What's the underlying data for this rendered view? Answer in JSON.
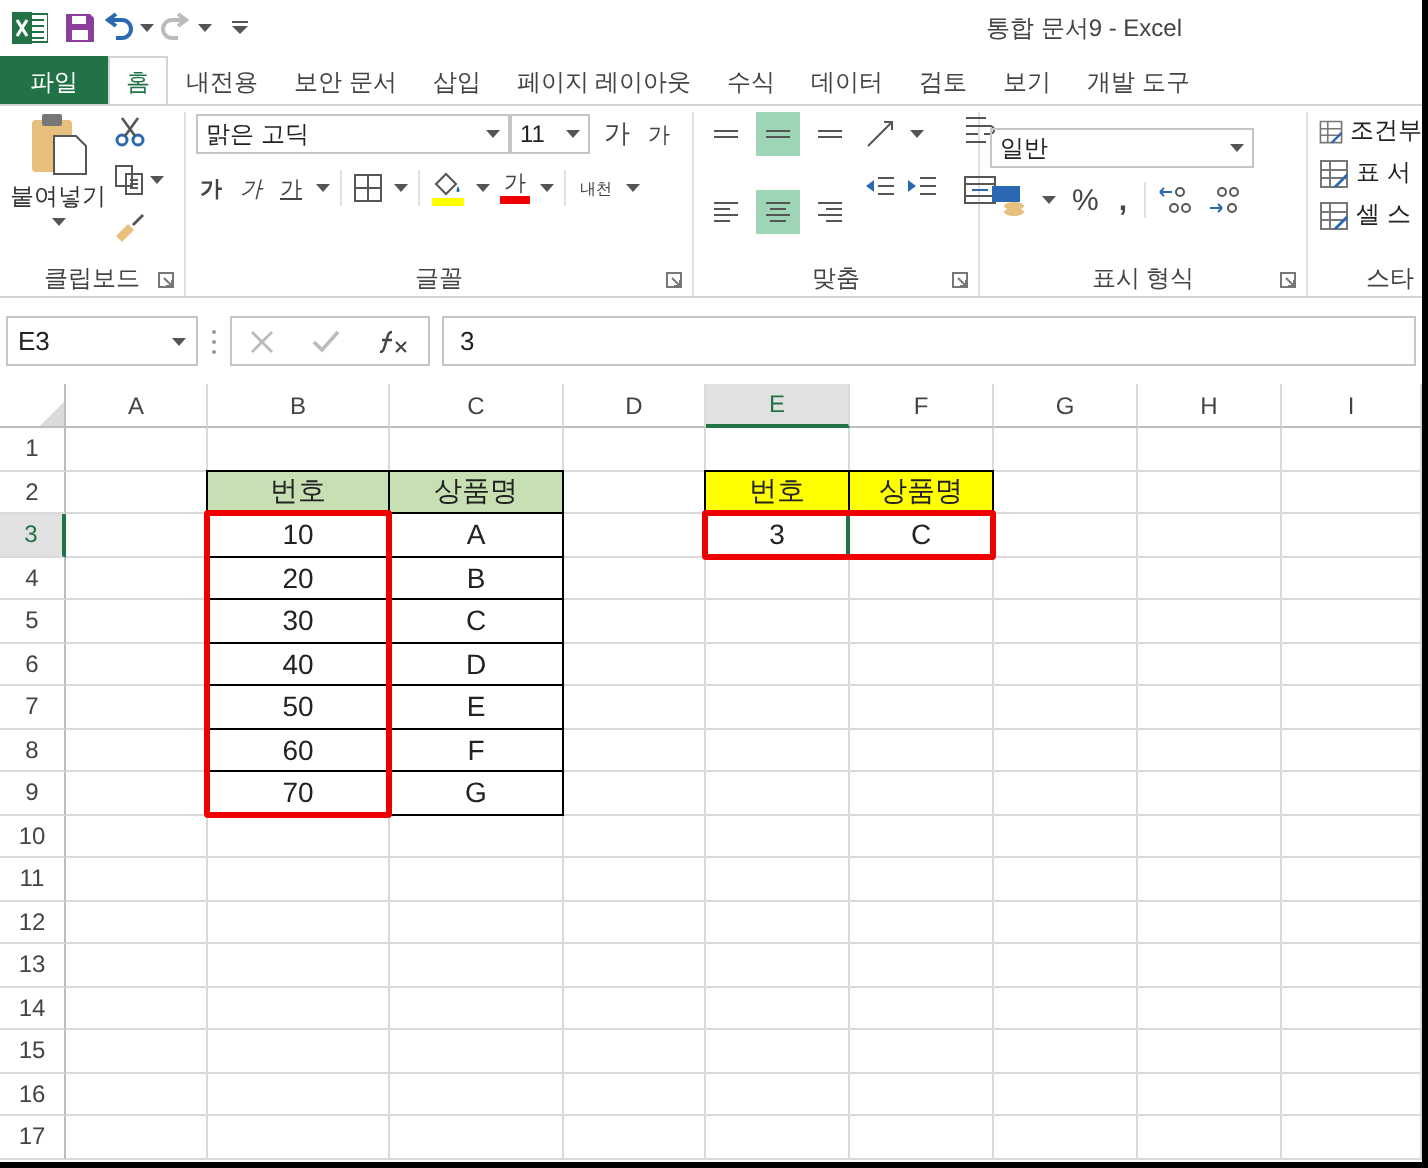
{
  "window": {
    "title": "통합 문서9 - Excel",
    "quick_access": [
      {
        "kind": "save"
      },
      {
        "kind": "undo",
        "disabled": false
      },
      {
        "kind": "redo",
        "disabled": true
      },
      {
        "kind": "customize"
      }
    ]
  },
  "tabs": [
    {
      "label": "파일",
      "kind": "file",
      "selected": false
    },
    {
      "label": "홈",
      "kind": "tab",
      "selected": true
    },
    {
      "label": "내전용",
      "kind": "tab",
      "selected": false
    },
    {
      "label": "보안 문서",
      "kind": "tab",
      "selected": false
    },
    {
      "label": "삽입",
      "kind": "tab",
      "selected": false
    },
    {
      "label": "페이지 레이아웃",
      "kind": "tab",
      "selected": false
    },
    {
      "label": "수식",
      "kind": "tab",
      "selected": false
    },
    {
      "label": "데이터",
      "kind": "tab",
      "selected": false
    },
    {
      "label": "검토",
      "kind": "tab",
      "selected": false
    },
    {
      "label": "보기",
      "kind": "tab",
      "selected": false
    },
    {
      "label": "개발 도구",
      "kind": "tab",
      "selected": false
    }
  ],
  "ribbon": {
    "clipboard": {
      "label": "클립보드",
      "paste": "붙여넣기"
    },
    "font": {
      "label": "글꼴",
      "name": "맑은 고딕",
      "size": "11",
      "grow": "가",
      "shrink": "가",
      "bold": "가",
      "italic": "가",
      "underline": "가",
      "font_color": "가",
      "phonetic": "내천"
    },
    "alignment": {
      "label": "맞춤",
      "buttons": [
        {
          "kind": "top",
          "selected": false
        },
        {
          "kind": "middle",
          "selected": true
        },
        {
          "kind": "bottom",
          "selected": false
        },
        {
          "kind": "left",
          "selected": false
        },
        {
          "kind": "center",
          "selected": true
        },
        {
          "kind": "right",
          "selected": false
        }
      ]
    },
    "number": {
      "label": "표시 형식",
      "format": "일반",
      "percent": "%",
      "comma": ","
    },
    "styles": {
      "label": "스타",
      "items": [
        "조건부",
        "표 서",
        "셀 스"
      ]
    }
  },
  "formula_bar": {
    "name_box": "E3",
    "value": "3"
  },
  "sheet": {
    "columns": [
      {
        "label": "A",
        "selected": false
      },
      {
        "label": "B",
        "selected": false
      },
      {
        "label": "C",
        "selected": false
      },
      {
        "label": "D",
        "selected": false
      },
      {
        "label": "E",
        "selected": true
      },
      {
        "label": "F",
        "selected": false
      },
      {
        "label": "G",
        "selected": false
      },
      {
        "label": "H",
        "selected": false
      },
      {
        "label": "I",
        "selected": false
      }
    ],
    "rows": [
      {
        "label": "1",
        "selected": false,
        "cells": []
      },
      {
        "label": "2",
        "selected": false,
        "cells": [
          "",
          {
            "text": "번호",
            "color": "#c6e0b4",
            "outlined": false
          },
          {
            "text": "상품명",
            "color": "#c6e0b4",
            "outlined": false
          },
          "",
          {
            "text": "번호",
            "color": "#ffff00",
            "outlined": false
          },
          {
            "text": "상품명",
            "color": "#ffff00",
            "outlined": false
          }
        ]
      },
      {
        "label": "3",
        "selected": true,
        "cells": [
          "",
          {
            "text": "10",
            "outlined": true
          },
          {
            "text": "A",
            "outlined": false
          },
          "",
          {
            "text": "3",
            "outlined": true
          },
          {
            "text": "C",
            "outlined": true
          }
        ]
      },
      {
        "label": "4",
        "selected": false,
        "cells": [
          "",
          {
            "text": "20",
            "outlined": true
          },
          {
            "text": "B",
            "outlined": false
          }
        ]
      },
      {
        "label": "5",
        "selected": false,
        "cells": [
          "",
          {
            "text": "30",
            "outlined": true
          },
          {
            "text": "C",
            "outlined": false
          }
        ]
      },
      {
        "label": "6",
        "selected": false,
        "cells": [
          "",
          {
            "text": "40",
            "outlined": true
          },
          {
            "text": "D",
            "outlined": false
          }
        ]
      },
      {
        "label": "7",
        "selected": false,
        "cells": [
          "",
          {
            "text": "50",
            "outlined": true
          },
          {
            "text": "E",
            "outlined": false
          }
        ]
      },
      {
        "label": "8",
        "selected": false,
        "cells": [
          "",
          {
            "text": "60",
            "outlined": true
          },
          {
            "text": "F",
            "outlined": false
          }
        ]
      },
      {
        "label": "9",
        "selected": false,
        "cells": [
          "",
          {
            "text": "70",
            "outlined": true
          },
          {
            "text": "G",
            "outlined": false
          }
        ]
      },
      {
        "label": "10",
        "selected": false,
        "cells": []
      },
      {
        "label": "11",
        "selected": false,
        "cells": []
      },
      {
        "label": "12",
        "selected": false,
        "cells": []
      },
      {
        "label": "13",
        "selected": false,
        "cells": []
      },
      {
        "label": "14",
        "selected": false,
        "cells": []
      },
      {
        "label": "15",
        "selected": false,
        "cells": []
      },
      {
        "label": "16",
        "selected": false,
        "cells": []
      },
      {
        "label": "17",
        "selected": false,
        "cells": []
      }
    ]
  }
}
